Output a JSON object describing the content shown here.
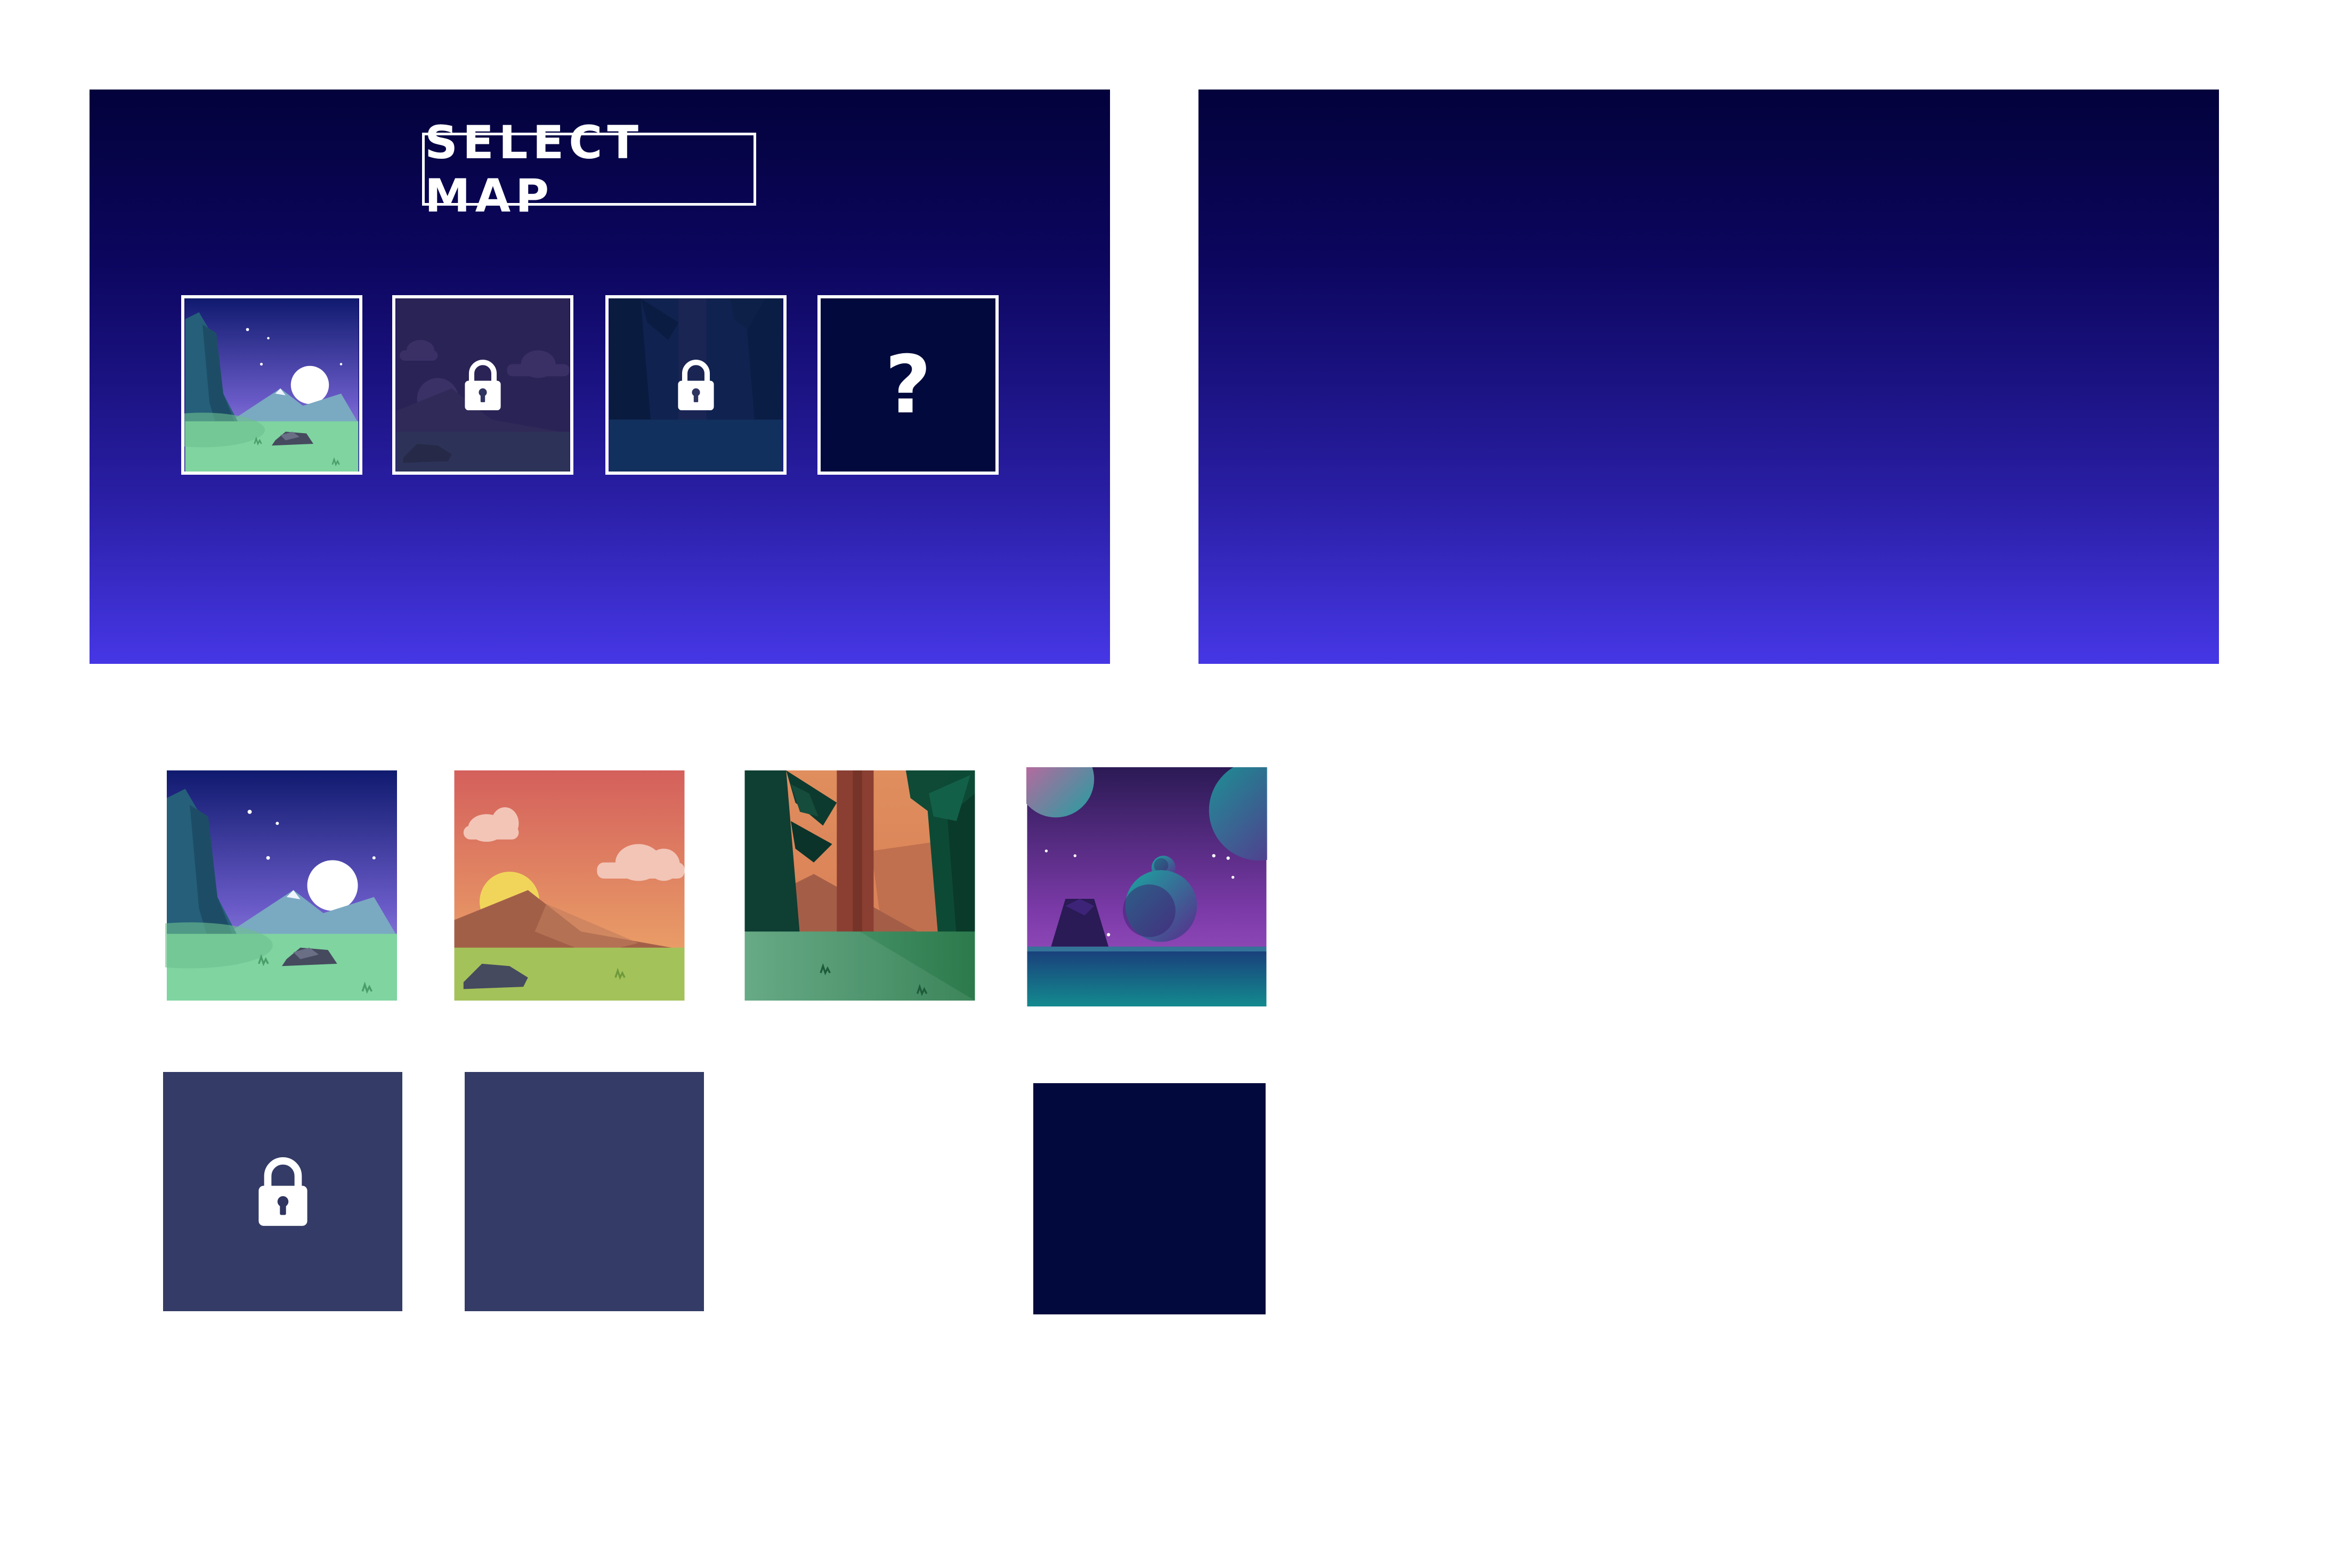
{
  "screen": {
    "title": "SELECT MAP"
  },
  "colors": {
    "panel_top": "#03023b",
    "panel_bottom": "#4637e6",
    "locked_tile": "#333b66",
    "unknown_tile": "#020a3d",
    "border": "#ffffff"
  },
  "map_slots": [
    {
      "map": "night-mountains",
      "state": "unlocked",
      "icon": ""
    },
    {
      "map": "sunset-hills",
      "state": "locked",
      "icon": "lock-icon"
    },
    {
      "map": "jungle",
      "state": "locked",
      "icon": "lock-icon"
    },
    {
      "map": "unknown",
      "state": "hidden",
      "icon": "question",
      "symbol": "?"
    }
  ],
  "map_thumbnails": [
    {
      "map": "night-mountains"
    },
    {
      "map": "sunset-hills"
    },
    {
      "map": "jungle"
    },
    {
      "map": "space-planets"
    }
  ],
  "asset_tiles": [
    {
      "kind": "locked-tile",
      "icon": "lock-icon"
    },
    {
      "kind": "locked-tile-blank"
    },
    {
      "kind": "unknown-tile-blank"
    }
  ]
}
